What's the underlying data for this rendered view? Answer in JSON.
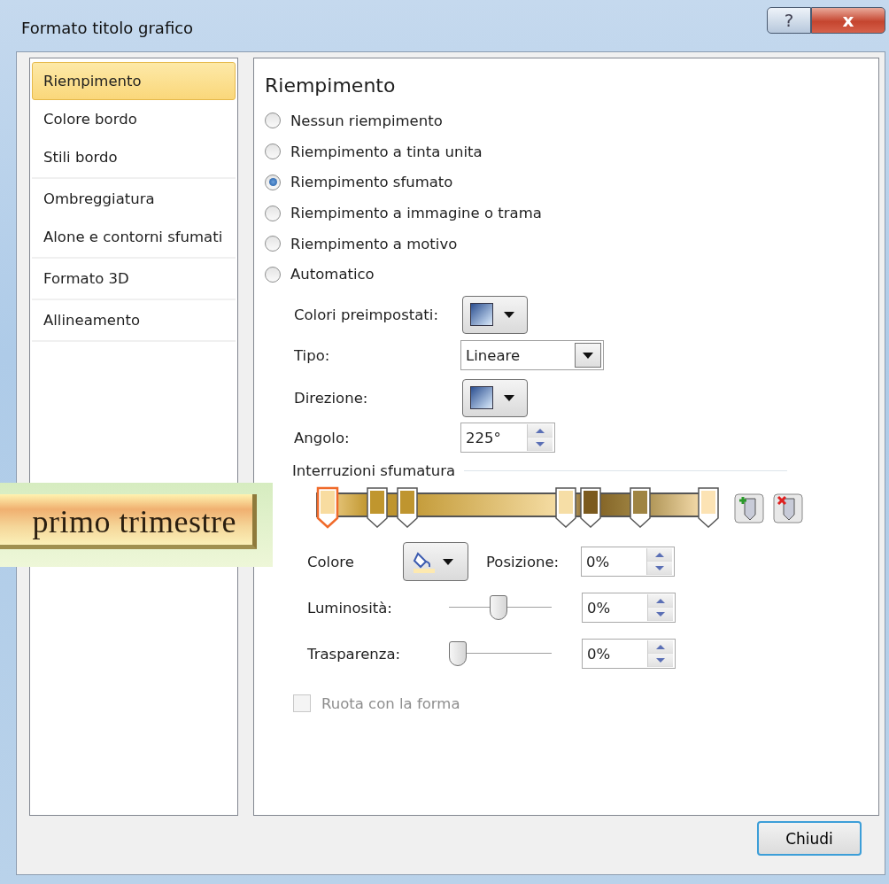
{
  "window": {
    "title": "Formato titolo grafico"
  },
  "title_buttons": [
    {
      "kind": "help",
      "label": "?"
    },
    {
      "kind": "close",
      "label": "x"
    }
  ],
  "sidebar": {
    "groups": [
      {
        "items": [
          {
            "label": "Riempimento",
            "selected": true
          },
          {
            "label": "Colore bordo",
            "selected": false
          },
          {
            "label": "Stili bordo",
            "selected": false
          }
        ]
      },
      {
        "items": [
          {
            "label": "Ombreggiatura",
            "selected": false
          },
          {
            "label": "Alone e contorni sfumati",
            "selected": false
          }
        ]
      },
      {
        "items": [
          {
            "label": "Formato 3D",
            "selected": false
          }
        ]
      },
      {
        "items": [
          {
            "label": "Allineamento",
            "selected": false
          }
        ]
      }
    ]
  },
  "panel": {
    "heading": "Riempimento",
    "fill_options": [
      {
        "label": "Nessun riempimento",
        "selected": false
      },
      {
        "label": "Riempimento a tinta unita",
        "selected": false
      },
      {
        "label": "Riempimento sfumato",
        "selected": true
      },
      {
        "label": "Riempimento a immagine o trama",
        "selected": false
      },
      {
        "label": "Riempimento a motivo",
        "selected": false
      },
      {
        "label": "Automatico",
        "selected": false
      }
    ],
    "preset_colors": {
      "label": "Colori preimpostati:"
    },
    "type": {
      "label": "Tipo:",
      "value": "Lineare"
    },
    "direction": {
      "label": "Direzione:"
    },
    "angle": {
      "label": "Angolo:",
      "value": "225°"
    },
    "stops_section": {
      "title": "Interruzioni sfumatura",
      "stops": [
        {
          "level": 0,
          "color": "#f8dca0",
          "selected": true
        },
        {
          "level": 0.13,
          "color": "#c0962e",
          "selected": false
        },
        {
          "level": 0.21,
          "color": "#bf952f",
          "selected": false
        },
        {
          "level": 0.625,
          "color": "#f6dea6",
          "selected": false
        },
        {
          "level": 0.69,
          "color": "#7b5a1e",
          "selected": false
        },
        {
          "level": 0.82,
          "color": "#9f8442",
          "selected": false
        },
        {
          "level": 1,
          "color": "#fce3b4",
          "selected": false
        }
      ]
    },
    "color": {
      "label": "Colore"
    },
    "position": {
      "label": "Posizione:",
      "value": "0%"
    },
    "brightness": {
      "label": "Luminosità:",
      "level": 0.5,
      "value": "0%"
    },
    "transparency": {
      "label": "Trasparenza:",
      "level": 0,
      "value": "0%"
    },
    "rotate": {
      "label": "Ruota con la forma",
      "checked": false,
      "disabled": true
    }
  },
  "close_button": "Chiudi",
  "chart_title_overlay": "primo trimestre"
}
